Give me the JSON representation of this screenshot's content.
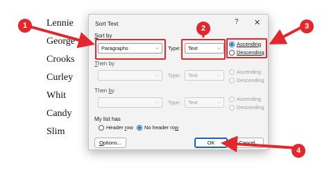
{
  "document": {
    "names": [
      "Lennie",
      "George",
      "Crooks",
      "Curley",
      "Whit",
      "Candy",
      "Slim"
    ]
  },
  "dialog": {
    "title": "Sort Text",
    "help_glyph": "?",
    "close_glyph": "✕",
    "sort_by": {
      "label_pre": "",
      "label_key": "S",
      "label_post": "ort by",
      "field_value": "Paragraphs",
      "type_label": "Type:",
      "type_value": "Text",
      "ascending": "Ascending",
      "descending": "Descending"
    },
    "then_by_1": {
      "label_pre": "",
      "label_key": "T",
      "label_post": "hen by",
      "type_label": "Type:",
      "type_value": "Text",
      "ascending": "Ascending",
      "descending": "Descending"
    },
    "then_by_2": {
      "label_pre": "Then ",
      "label_key": "b",
      "label_post": "y",
      "type_label": "Type:",
      "type_value": "Text",
      "ascending": "Ascending",
      "descending": "Descending"
    },
    "list_has": {
      "label": "My list has",
      "header_row_pre": "Header ",
      "header_row_key": "r",
      "header_row_post": "ow",
      "no_header_row_pre": "No header ro",
      "no_header_row_key": "w",
      "no_header_row_post": ""
    },
    "options_pre": "",
    "options_key": "O",
    "options_post": "ptions...",
    "ok_label": "OK",
    "cancel_label": "Cancel",
    "dropdown_arrow": "⌵"
  },
  "callouts": [
    "1",
    "2",
    "3",
    "4"
  ],
  "colors": {
    "annotation": "#e0282e",
    "accent": "#1a5fb4"
  }
}
